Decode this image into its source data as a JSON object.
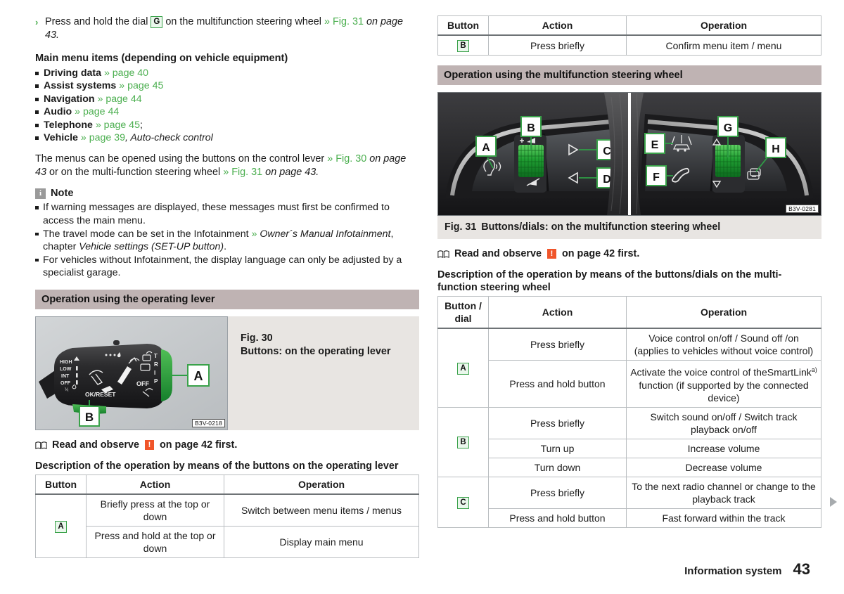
{
  "left": {
    "action_step": {
      "arrow": "›",
      "text_1": "Press and hold the dial ",
      "key": "G",
      "text_2": " on the multifunction steering wheel ",
      "ref": "» Fig. 31",
      "ref_italic": " on page 43."
    },
    "menu_heading": "Main menu items (depending on vehicle equipment)",
    "menu_items": [
      {
        "label": "Driving data",
        "ref": "» page 40",
        "tail": ""
      },
      {
        "label": "Assist systems",
        "ref": "» page 45",
        "tail": ""
      },
      {
        "label": "Navigation",
        "ref": "» page 44",
        "tail": ""
      },
      {
        "label": "Audio",
        "ref": "» page 44",
        "tail": ""
      },
      {
        "label": "Telephone",
        "ref": "» page 45",
        "tail": ";"
      },
      {
        "label": "Vehicle",
        "ref": "» page 39",
        "tail": ", Auto-check control"
      }
    ],
    "menus_para": {
      "t1": "The menus can be opened using the buttons on the control lever ",
      "ref1": "» Fig. 30",
      "i1": " on page 43",
      "t2": " or on the multi-function steering wheel ",
      "ref2": "» Fig. 31",
      "i2": " on page 43."
    },
    "note": {
      "icon_letter": "i",
      "title": "Note",
      "items": [
        {
          "plain": "If warning messages are displayed, these messages must first be confirmed to access the main menu."
        },
        {
          "plain": "The travel mode can be set in the Infotainment ",
          "ref": "»",
          "italic": " Owner´s Manual Infotainment",
          "plain2": ", chapter ",
          "italic2": "Vehicle settings (SET-UP button)",
          "plain3": "."
        },
        {
          "plain": "For vehicles without Infotainment, the display language can only be adjusted by a specialist garage."
        }
      ]
    },
    "band": "Operation using the operating lever",
    "fig30": {
      "number": "Fig. 30",
      "caption": "Buttons: on the operating lever",
      "code": "B3V-0218",
      "labels": [
        "A",
        "B"
      ],
      "lever_text": {
        "high": "HIGH",
        "low": "LOW",
        "int": "INT",
        "off": "OFF",
        "okreset": "OK/RESET",
        "off2": "OFF",
        "trip": "TRIP"
      }
    },
    "observe": {
      "text_1": "Read and observe ",
      "warn": "!",
      "text_2": " on page 42 first."
    },
    "table_title": "Description of the operation by means of the buttons on the operating lever",
    "table": {
      "headers": [
        "Button",
        "Action",
        "Operation"
      ],
      "rows": [
        {
          "key": "A",
          "rowspan": 2,
          "action": "Briefly press at the top or down",
          "operation": "Switch between menu items / menus"
        },
        {
          "key": "",
          "rowspan": 0,
          "action": "Press and hold at the top or down",
          "operation": "Display main menu"
        }
      ]
    }
  },
  "right": {
    "table_top": {
      "headers": [
        "Button",
        "Action",
        "Operation"
      ],
      "rows": [
        {
          "key": "B",
          "action": "Press briefly",
          "operation": "Confirm menu item / menu"
        }
      ]
    },
    "band": "Operation using the multifunction steering wheel",
    "fig31": {
      "number": "Fig. 31",
      "caption": "Buttons/dials: on the multifunction steering wheel",
      "code": "B3V-0281",
      "labels": [
        "A",
        "B",
        "C",
        "D",
        "E",
        "F",
        "G",
        "H"
      ]
    },
    "observe": {
      "text_1": "Read and observe ",
      "warn": "!",
      "text_2": " on page 42 first."
    },
    "table_title": "Description of the operation by means of the buttons/dials on the multi-function steering wheel",
    "table": {
      "headers": [
        "Button / dial",
        "Action",
        "Operation"
      ],
      "groups": [
        {
          "key": "A",
          "rows": [
            {
              "action": "Press briefly",
              "operation": "Voice control on/off / Sound off /on (applies to vehicles without voice control)"
            },
            {
              "action": "Press and hold button",
              "operation": "Activate the voice control of theSmartLink",
              "sup": "a)",
              "operation2": " function (if supported by the connected device)"
            }
          ]
        },
        {
          "key": "B",
          "rows": [
            {
              "action": "Press briefly",
              "operation": "Switch sound on/off / Switch track playback on/off"
            },
            {
              "action": "Turn up",
              "operation": "Increase volume"
            },
            {
              "action": "Turn down",
              "operation": "Decrease volume"
            }
          ]
        },
        {
          "key": "C",
          "rows": [
            {
              "action": "Press briefly",
              "operation": "To the next radio channel or change to the playback track"
            },
            {
              "action": "Press and hold button",
              "operation": "Fast forward within the track"
            }
          ]
        }
      ]
    }
  },
  "footer": {
    "title": "Information system",
    "page": "43"
  },
  "colors": {
    "link_green": "#4caf50",
    "key_border_green": "#3aa24a",
    "band_bg": "#bfb3b3",
    "figure_bg": "#e8e5e2",
    "warn_orange": "#f0552a",
    "note_gray": "#9a9a9a"
  }
}
